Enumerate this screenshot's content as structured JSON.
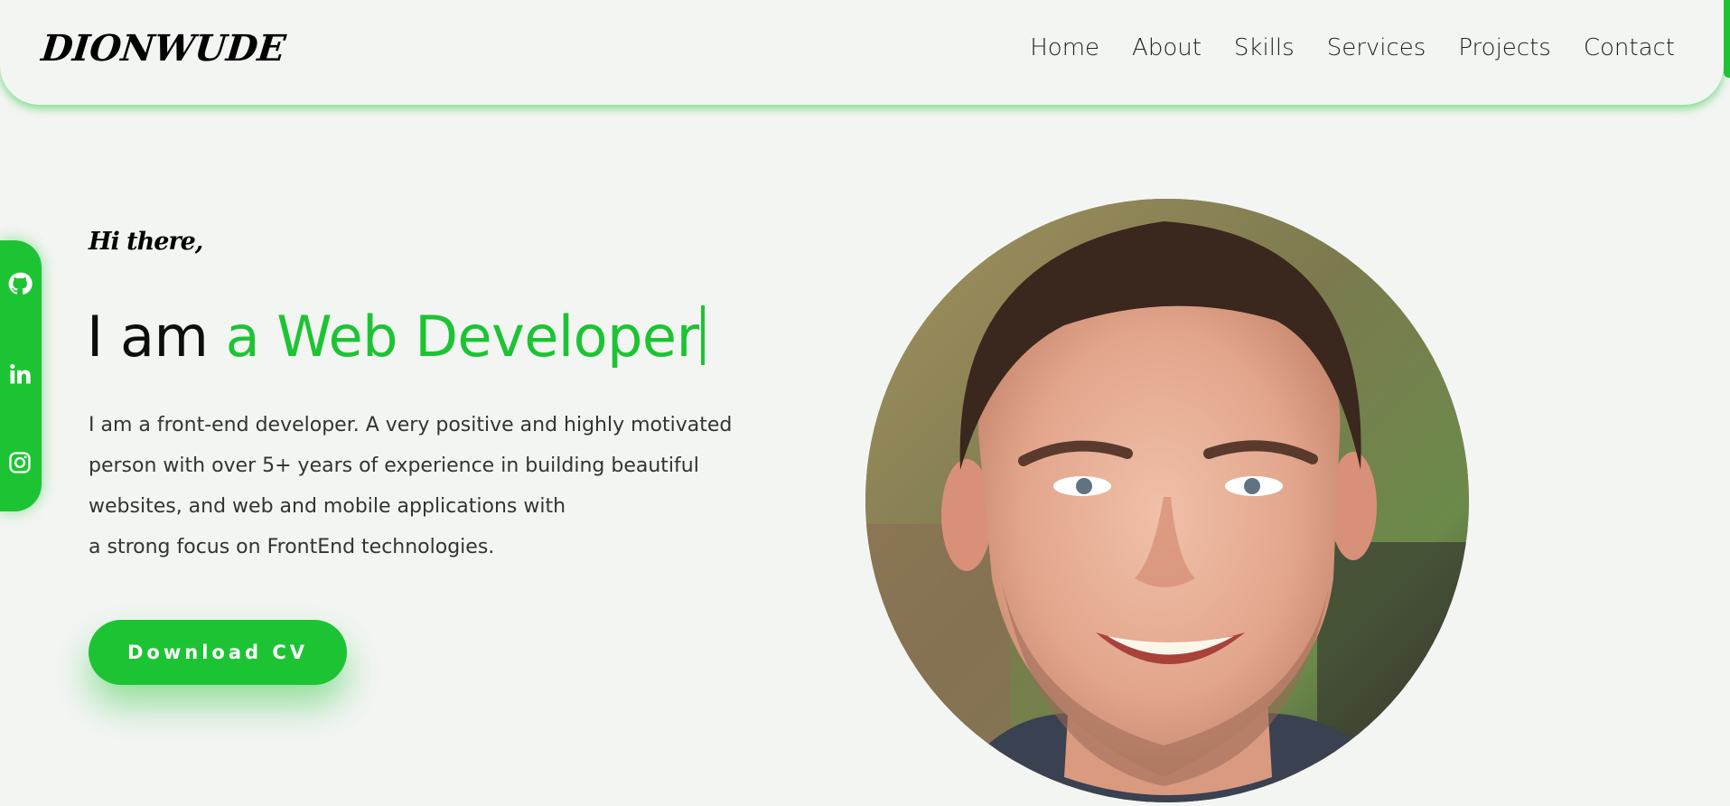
{
  "header": {
    "logo": "DIONWUDE",
    "nav": [
      "Home",
      "About",
      "Skills",
      "Services",
      "Projects",
      "Contact"
    ]
  },
  "social": {
    "icons": [
      "github-icon",
      "linkedin-icon",
      "instagram-icon"
    ]
  },
  "hero": {
    "greeting": "Hi there,",
    "headline_prefix": "I am",
    "headline_accent": "a Web Developer",
    "description_lines": [
      "I am a front-end developer. A very positive and highly motivated",
      "person with over 5+ years of experience in building beautiful",
      "websites, and web and mobile applications with",
      "a strong focus on FrontEnd technologies."
    ],
    "cta_label": "Download CV"
  },
  "colors": {
    "accent": "#1cc433",
    "background": "#f3f5f3",
    "text": "#111111"
  }
}
